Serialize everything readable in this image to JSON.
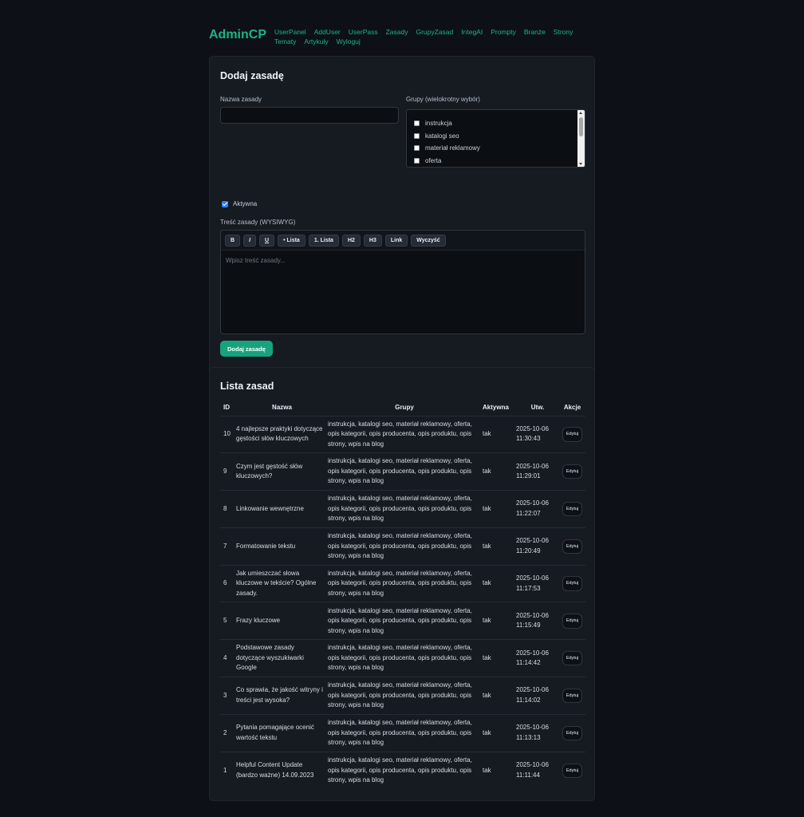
{
  "brand": "AdminCP",
  "nav": [
    "UserPanel",
    "AddUser",
    "UserPass",
    "Zasady",
    "GrupyZasad",
    "IntegAI",
    "Prompty",
    "Branże",
    "Strony",
    "Tematy",
    "Artykuły",
    "Wyloguj"
  ],
  "form": {
    "title": "Dodaj zasadę",
    "name_label": "Nazwa zasady",
    "name_value": "",
    "groups_label": "Grupy (wielokrotny wybór)",
    "groups_options": [
      "instrukcja",
      "katalogi seo",
      "materiał reklamowy",
      "oferta"
    ],
    "active_label": "Aktywna",
    "active_checked": true,
    "content_label": "Treść zasady (WYSIWYG)",
    "toolbar": [
      "B",
      "I",
      "U",
      "• Lista",
      "1. Lista",
      "H2",
      "H3",
      "Link",
      "Wyczyść"
    ],
    "editor_placeholder": "Wpisz treść zasady...",
    "submit_label": "Dodaj zasadę"
  },
  "list": {
    "title": "Lista zasad",
    "columns": [
      "ID",
      "Nazwa",
      "Grupy",
      "Aktywna",
      "Utw.",
      "Akcje"
    ],
    "edit_label": "Edytuj",
    "rows": [
      {
        "id": "10",
        "name": "4 najlepsze praktyki dotyczące gęstości słów kluczowych",
        "groups": "instrukcja, katalogi seo, materiał reklamowy, oferta, opis kategorii, opis producenta, opis produktu, opis strony, wpis na blog",
        "active": "tak",
        "date": "2025-10-06 11:30:43"
      },
      {
        "id": "9",
        "name": "Czym jest gęstość słów kluczowych?",
        "groups": "instrukcja, katalogi seo, materiał reklamowy, oferta, opis kategorii, opis producenta, opis produktu, opis strony, wpis na blog",
        "active": "tak",
        "date": "2025-10-06 11:29:01"
      },
      {
        "id": "8",
        "name": "Linkowanie wewnętrzne",
        "groups": "instrukcja, katalogi seo, materiał reklamowy, oferta, opis kategorii, opis producenta, opis produktu, opis strony, wpis na blog",
        "active": "tak",
        "date": "2025-10-06 11:22:07"
      },
      {
        "id": "7",
        "name": "Formatowanie tekstu",
        "groups": "instrukcja, katalogi seo, materiał reklamowy, oferta, opis kategorii, opis producenta, opis produktu, opis strony, wpis na blog",
        "active": "tak",
        "date": "2025-10-06 11:20:49"
      },
      {
        "id": "6",
        "name": "Jak umieszczać słowa kluczowe w tekście? Ogólne zasady.",
        "groups": "instrukcja, katalogi seo, materiał reklamowy, oferta, opis kategorii, opis producenta, opis produktu, opis strony, wpis na blog",
        "active": "tak",
        "date": "2025-10-06 11:17:53"
      },
      {
        "id": "5",
        "name": "Frazy kluczowe",
        "groups": "instrukcja, katalogi seo, materiał reklamowy, oferta, opis kategorii, opis producenta, opis produktu, opis strony, wpis na blog",
        "active": "tak",
        "date": "2025-10-06 11:15:49"
      },
      {
        "id": "4",
        "name": "Podstawowe zasady dotyczące wyszukiwarki Google",
        "groups": "instrukcja, katalogi seo, materiał reklamowy, oferta, opis kategorii, opis producenta, opis produktu, opis strony, wpis na blog",
        "active": "tak",
        "date": "2025-10-06 11:14:42"
      },
      {
        "id": "3",
        "name": "Co sprawia, że jakość witryny i treści jest wysoka?",
        "groups": "instrukcja, katalogi seo, materiał reklamowy, oferta, opis kategorii, opis producenta, opis produktu, opis strony, wpis na blog",
        "active": "tak",
        "date": "2025-10-06 11:14:02"
      },
      {
        "id": "2",
        "name": "Pytania pomagające ocenić wartość tekstu",
        "groups": "instrukcja, katalogi seo, materiał reklamowy, oferta, opis kategorii, opis producenta, opis produktu, opis strony, wpis na blog",
        "active": "tak",
        "date": "2025-10-06 11:13:13"
      },
      {
        "id": "1",
        "name": "Helpful Content Update (bardzo ważne) 14.09.2023",
        "groups": "instrukcja, katalogi seo, materiał reklamowy, oferta, opis kategorii, opis producenta, opis produktu, opis strony, wpis na blog",
        "active": "tak",
        "date": "2025-10-06 11:11:44"
      }
    ]
  }
}
